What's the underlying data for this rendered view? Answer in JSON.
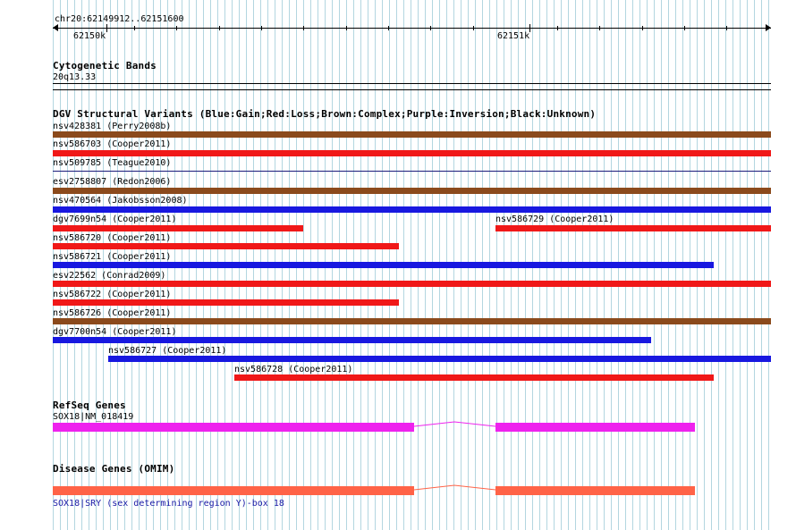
{
  "ruler": {
    "range": "chr20:62149912..62151600",
    "tick_left": "62150k",
    "tick_right": "62151k"
  },
  "cytoband": {
    "title": "Cytogenetic Bands",
    "band": "20q13.33"
  },
  "dgv": {
    "title": "DGV Structural Variants (Blue:Gain;Red:Loss;Brown:Complex;Purple:Inversion;Black:Unknown)",
    "colors": {
      "gain": "#1818e0",
      "loss": "#f01818",
      "complex": "#8b4a1c",
      "unknown": "#000000"
    },
    "variants": [
      {
        "label": "nsv428381 (Perry2008b)",
        "type": "complex"
      },
      {
        "label": "nsv586703 (Cooper2011)",
        "type": "loss"
      },
      {
        "label": "nsv509785 (Teague2010)",
        "type": "thin"
      },
      {
        "label": "esv2758807 (Redon2006)",
        "type": "complex"
      },
      {
        "label": "nsv470564 (Jakobsson2008)",
        "type": "gain"
      },
      {
        "label": "dgv7699n54 (Cooper2011)",
        "type": "loss"
      },
      {
        "label": "nsv586729 (Cooper2011)",
        "type": "loss"
      },
      {
        "label": "nsv586720 (Cooper2011)",
        "type": "loss"
      },
      {
        "label": "nsv586721 (Cooper2011)",
        "type": "gain"
      },
      {
        "label": "esv22562 (Conrad2009)",
        "type": "loss"
      },
      {
        "label": "nsv586722 (Cooper2011)",
        "type": "loss"
      },
      {
        "label": "nsv586726 (Cooper2011)",
        "type": "complex"
      },
      {
        "label": "dgv7700n54 (Cooper2011)",
        "type": "gain"
      },
      {
        "label": "nsv586727 (Cooper2011)",
        "type": "gain"
      },
      {
        "label": "nsv586728 (Cooper2011)",
        "type": "loss"
      }
    ]
  },
  "refseq": {
    "title": "RefSeq Genes",
    "gene": "SOX18|NM_018419",
    "color": "#ee22ee"
  },
  "omim": {
    "title": "Disease Genes (OMIM)",
    "gene": "SOX18|SRY (sex determining region Y)-box 18",
    "color": "#ff6347",
    "link_color": "#1a1aa6"
  }
}
